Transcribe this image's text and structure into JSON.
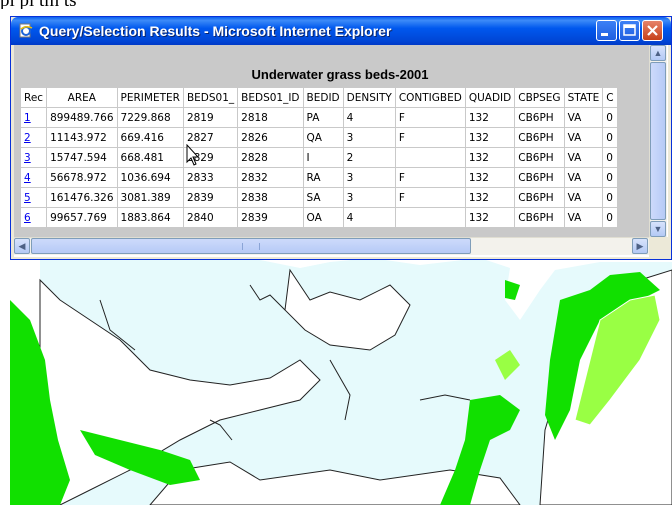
{
  "page_header_fragment": "pl pl tm ts",
  "window": {
    "title": "Query/Selection Results - Microsoft Internet Explorer",
    "icon": "ie-page-icon",
    "controls": [
      "minimize-icon",
      "maximize-icon",
      "close-icon"
    ]
  },
  "results": {
    "title": "Underwater grass beds-2001",
    "columns": [
      "Rec",
      "AREA",
      "PERIMETER",
      "BEDS01_",
      "BEDS01_ID",
      "BEDID",
      "DENSITY",
      "CONTIGBED",
      "QUADID",
      "CBPSEG",
      "STATE",
      "C"
    ],
    "rows": [
      {
        "rec": "1",
        "area": "899489.766",
        "perimeter": "7229.868",
        "beds01": "2819",
        "beds01_id": "2818",
        "bedid": "PA",
        "density": "4",
        "contigbed": "F",
        "quadid": "132",
        "cbpseg": "CB6PH",
        "state": "VA",
        "c": "0"
      },
      {
        "rec": "2",
        "area": "11143.972",
        "perimeter": "669.416",
        "beds01": "2827",
        "beds01_id": "2826",
        "bedid": "QA",
        "density": "3",
        "contigbed": "F",
        "quadid": "132",
        "cbpseg": "CB6PH",
        "state": "VA",
        "c": "0"
      },
      {
        "rec": "3",
        "area": "15747.594",
        "perimeter": "668.481",
        "beds01": "2829",
        "beds01_id": "2828",
        "bedid": "I",
        "density": "2",
        "contigbed": "",
        "quadid": "132",
        "cbpseg": "CB6PH",
        "state": "VA",
        "c": "0"
      },
      {
        "rec": "4",
        "area": "56678.972",
        "perimeter": "1036.694",
        "beds01": "2833",
        "beds01_id": "2832",
        "bedid": "RA",
        "density": "3",
        "contigbed": "F",
        "quadid": "132",
        "cbpseg": "CB6PH",
        "state": "VA",
        "c": "0"
      },
      {
        "rec": "5",
        "area": "161476.326",
        "perimeter": "3081.389",
        "beds01": "2839",
        "beds01_id": "2838",
        "bedid": "SA",
        "density": "3",
        "contigbed": "F",
        "quadid": "132",
        "cbpseg": "CB6PH",
        "state": "VA",
        "c": "0"
      },
      {
        "rec": "6",
        "area": "99657.769",
        "perimeter": "1883.864",
        "beds01": "2840",
        "beds01_id": "2839",
        "bedid": "OA",
        "density": "4",
        "contigbed": "",
        "quadid": "132",
        "cbpseg": "CB6PH",
        "state": "VA",
        "c": "0"
      }
    ]
  },
  "map": {
    "water_color": "#e6fafc",
    "land_color": "#ffffff",
    "grass_color": "#11e000",
    "light_grass_color": "#99ff44",
    "shoreline_color": "#222222"
  }
}
